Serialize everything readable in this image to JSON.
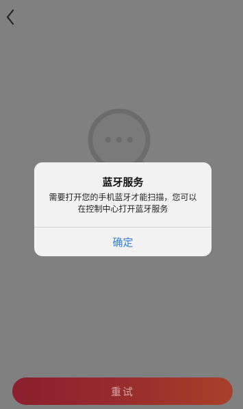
{
  "nav": {
    "back_icon": "chevron-left-icon"
  },
  "illustration": {
    "icon": "search-chat-icon"
  },
  "dialog": {
    "title": "蓝牙服务",
    "message": "需要打开您的手机蓝牙才能扫描，您可以在控制中心打开蓝牙服务",
    "confirm_label": "确定"
  },
  "footer": {
    "retry_label": "重试"
  },
  "colors": {
    "overlay_background": "#808080",
    "dialog_background": "#f2f2f2",
    "confirm_text": "#2f7fd6",
    "retry_button": "#962a2d"
  }
}
